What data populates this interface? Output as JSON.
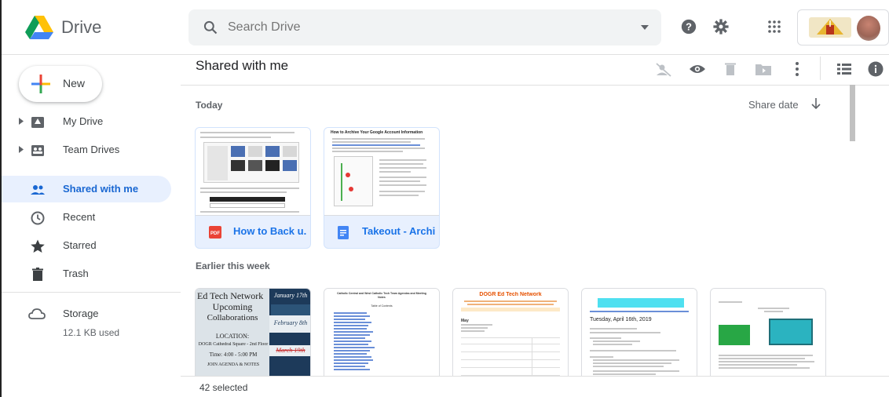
{
  "app": {
    "name": "Drive"
  },
  "search": {
    "placeholder": "Search Drive"
  },
  "new_button": {
    "label": "New"
  },
  "sidebar": {
    "items": [
      {
        "label": "My Drive",
        "icon": "my-drive-icon"
      },
      {
        "label": "Team Drives",
        "icon": "team-drives-icon"
      },
      {
        "label": "Shared with me",
        "icon": "people-icon"
      },
      {
        "label": "Recent",
        "icon": "clock-icon"
      },
      {
        "label": "Starred",
        "icon": "star-icon"
      },
      {
        "label": "Trash",
        "icon": "trash-icon"
      }
    ],
    "storage": {
      "label": "Storage",
      "used": "12.1 KB used",
      "icon": "cloud-icon"
    }
  },
  "main": {
    "title": "Shared with me",
    "sort": {
      "label": "Share date",
      "icon": "arrow-down-icon"
    },
    "sections": [
      {
        "label": "Today",
        "files": [
          {
            "name": "How to Back u...",
            "type": "pdf",
            "type_label": "PDF"
          },
          {
            "name": "Takeout - Archi...",
            "type": "doc"
          }
        ]
      },
      {
        "label": "Earlier this week",
        "files": []
      }
    ],
    "thumbnails": {
      "takeout_title": "How to Archive Your Google Account Information",
      "ed_tech": {
        "title": "Ed Tech Network",
        "upcoming": "Upcoming",
        "collaborations": "Collaborations",
        "date1": "January 17th",
        "date2": "February 8th",
        "date3": "March 19th",
        "location_label": "LOCATION:",
        "location": "DOGR Cathedral Square - 2nd Floor",
        "time": "Time: 4:00 - 5:00 PM",
        "footer": "JOIN AGENDA & NOTES"
      },
      "notes_title": "Catholic Central and West Catholic Tech Team Agendas and Meeting Notes",
      "notes_sub": "Table of Contents",
      "dogr": {
        "title": "DOGR Ed Tech Network",
        "month": "May"
      },
      "agenda_date": "Tuesday, April 16th, 2019"
    }
  },
  "status": {
    "selected_text": "42 selected"
  },
  "colors": {
    "accent": "#1a73e8",
    "active_bg": "#e8f0fe",
    "pdf_red": "#ea4335",
    "doc_blue": "#4285f4"
  }
}
